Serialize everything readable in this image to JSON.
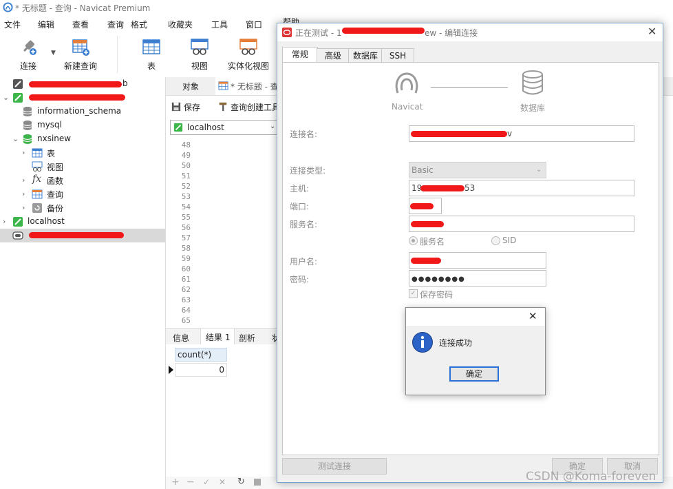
{
  "app": {
    "title": "* 无标题 - 查询 - Navicat Premium"
  },
  "menu": [
    "文件",
    "编辑",
    "查看",
    "查询",
    "格式",
    "收藏夹",
    "工具",
    "窗口",
    "帮助"
  ],
  "toolbar": {
    "connect": "连接",
    "new_query": "新建查询",
    "table": "表",
    "view": "视图",
    "materialized_view": "实体化视图"
  },
  "sidebar": {
    "information_schema": "information_schema",
    "mysql": "mysql",
    "nxsinew": "nxsinew",
    "table": "表",
    "view": "视图",
    "function": "函数",
    "query": "查询",
    "backup": "备份",
    "localhost": "localhost",
    "partial_1": "b"
  },
  "tabs": {
    "objects": "对象",
    "query_tab": "* 无标题 - 查"
  },
  "query_toolbar": {
    "save": "保存",
    "query_builder": "查询创建工具",
    "connection": "localhost"
  },
  "editor": {
    "line_numbers": [
      "48",
      "49",
      "50",
      "51",
      "52",
      "53",
      "54",
      "55",
      "56",
      "57",
      "58",
      "59",
      "60",
      "61",
      "62",
      "63",
      "64",
      "65"
    ]
  },
  "result_tabs": [
    "信息",
    "结果 1",
    "剖析",
    "状"
  ],
  "grid": {
    "header": "count(*)",
    "value": "0"
  },
  "dialog": {
    "title_prefix": "正在测试 - 1",
    "title_suffix": "ew - 编辑连接",
    "tabs": [
      "常规",
      "高级",
      "数据库",
      "SSH"
    ],
    "navicat_label": "Navicat",
    "database_label": "数据库",
    "fields": {
      "conn_name_label": "连接名:",
      "conn_type_label": "连接类型:",
      "conn_type_value": "Basic",
      "host_label": "主机:",
      "host_prefix": "19",
      "host_suffix": "53",
      "port_label": "端口:",
      "service_label": "服务名:",
      "service_name_radio": "服务名",
      "sid_radio": "SID",
      "user_label": "用户名:",
      "password_label": "密码:",
      "password_value": "●●●●●●●●",
      "save_password": "保存密码",
      "conn_name_suffix": "v"
    },
    "buttons": {
      "test": "测试连接",
      "ok": "确定",
      "cancel": "取消"
    }
  },
  "msgbox": {
    "message": "连接成功",
    "ok": "确定"
  },
  "watermark": "CSDN @Koma-foreven",
  "colors": {
    "accent": "#3c7fd1",
    "redact": "#f01818",
    "navicat_green": "#3cb64a"
  }
}
